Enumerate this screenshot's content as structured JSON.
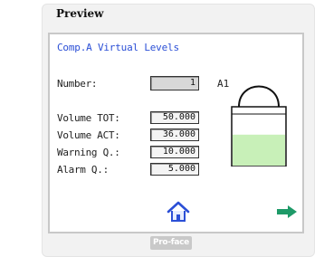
{
  "panel": {
    "title": "Preview"
  },
  "screen": {
    "title": "Comp.A Virtual Levels",
    "number_label": "Number:",
    "number_value": "1",
    "tank_id": "A1",
    "fields": [
      {
        "label": "Volume TOT:",
        "value": "50.000"
      },
      {
        "label": "Volume ACT:",
        "value": "36.000"
      },
      {
        "label": "Warning Q.:",
        "value": "10.000"
      },
      {
        "label": "Alarm Q.:",
        "value": "5.000"
      }
    ],
    "tank_fill_fraction": 0.6,
    "tank_fill_color": "#c8f0b8",
    "home_icon": "home-icon",
    "next_icon": "arrow-right-icon",
    "accent_color": "#2b4fd6",
    "arrow_color": "#1e9a68"
  },
  "footer": {
    "logo_text": "Pro-face"
  }
}
